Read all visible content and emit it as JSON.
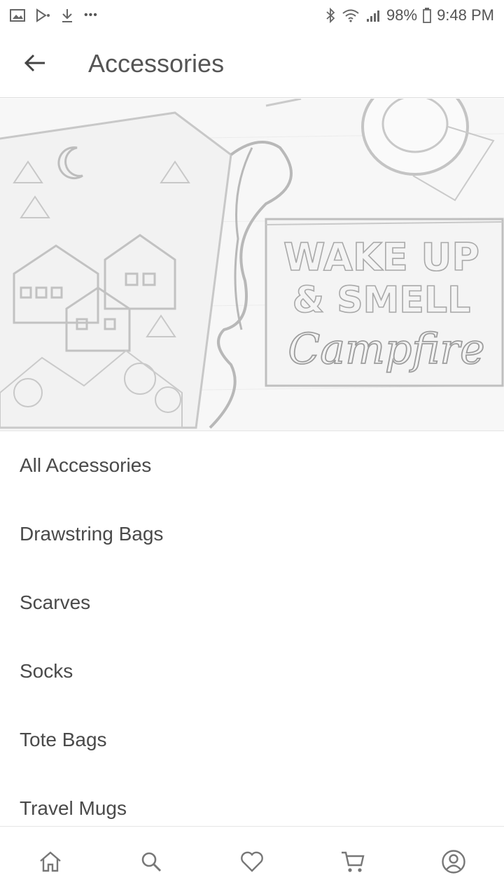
{
  "status_bar": {
    "left_icons": [
      "gallery-icon",
      "play-icon",
      "download-icon",
      "more-icon"
    ],
    "more_label": "•••",
    "battery": "98%",
    "time": "9:48 PM"
  },
  "app_bar": {
    "title": "Accessories",
    "back_icon": "arrow-left-icon"
  },
  "hero": {
    "lines": [
      "WAKE UP",
      "& SMELL",
      "Campfire"
    ]
  },
  "categories": [
    {
      "label": "All Accessories"
    },
    {
      "label": "Drawstring Bags"
    },
    {
      "label": "Scarves"
    },
    {
      "label": "Socks"
    },
    {
      "label": "Tote Bags"
    },
    {
      "label": "Travel Mugs"
    }
  ],
  "bottom_nav": [
    "home-icon",
    "search-icon",
    "heart-icon",
    "cart-icon",
    "account-icon"
  ],
  "colors": {
    "icon": "#777777",
    "text": "#4a4a4a",
    "divider": "#dcdcdc"
  }
}
